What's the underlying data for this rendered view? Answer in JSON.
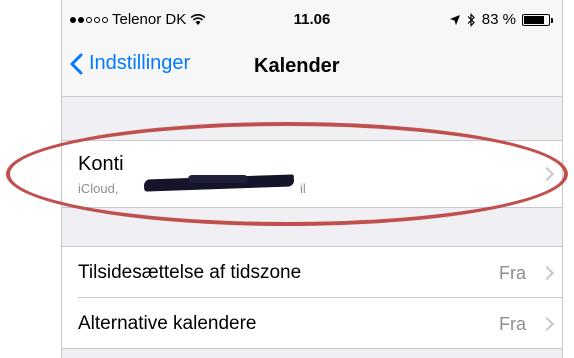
{
  "status_bar": {
    "carrier": "Telenor DK",
    "time": "11.06",
    "battery_text": "83 %",
    "battery_level": 0.83,
    "signal_bars": 2,
    "wifi_icon": "wifi-icon",
    "location_icon": "location-arrow-icon",
    "bluetooth_icon": "bluetooth-icon"
  },
  "navbar": {
    "back_label": "Indstillinger",
    "title": "Kalender"
  },
  "accounts_row": {
    "label": "Konti",
    "sub_visible": "iCloud,",
    "sub_tail": "il"
  },
  "settings": [
    {
      "label": "Tilsidesættelse af tidszone",
      "value": "Fra"
    },
    {
      "label": "Alternative kalendere",
      "value": "Fra"
    }
  ],
  "colors": {
    "accent": "#007aff",
    "annotation": "#c0504d"
  }
}
